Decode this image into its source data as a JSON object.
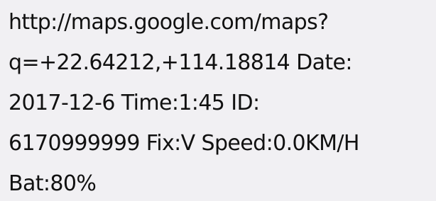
{
  "message": {
    "lines": [
      "http://maps.google.com/maps?",
      "q=+22.64212,+114.18814 Date:",
      "2017-12-6 Time:1:45 ID:",
      "6170999999 Fix:V Speed:0.0KM/H",
      "Bat:80%"
    ]
  }
}
